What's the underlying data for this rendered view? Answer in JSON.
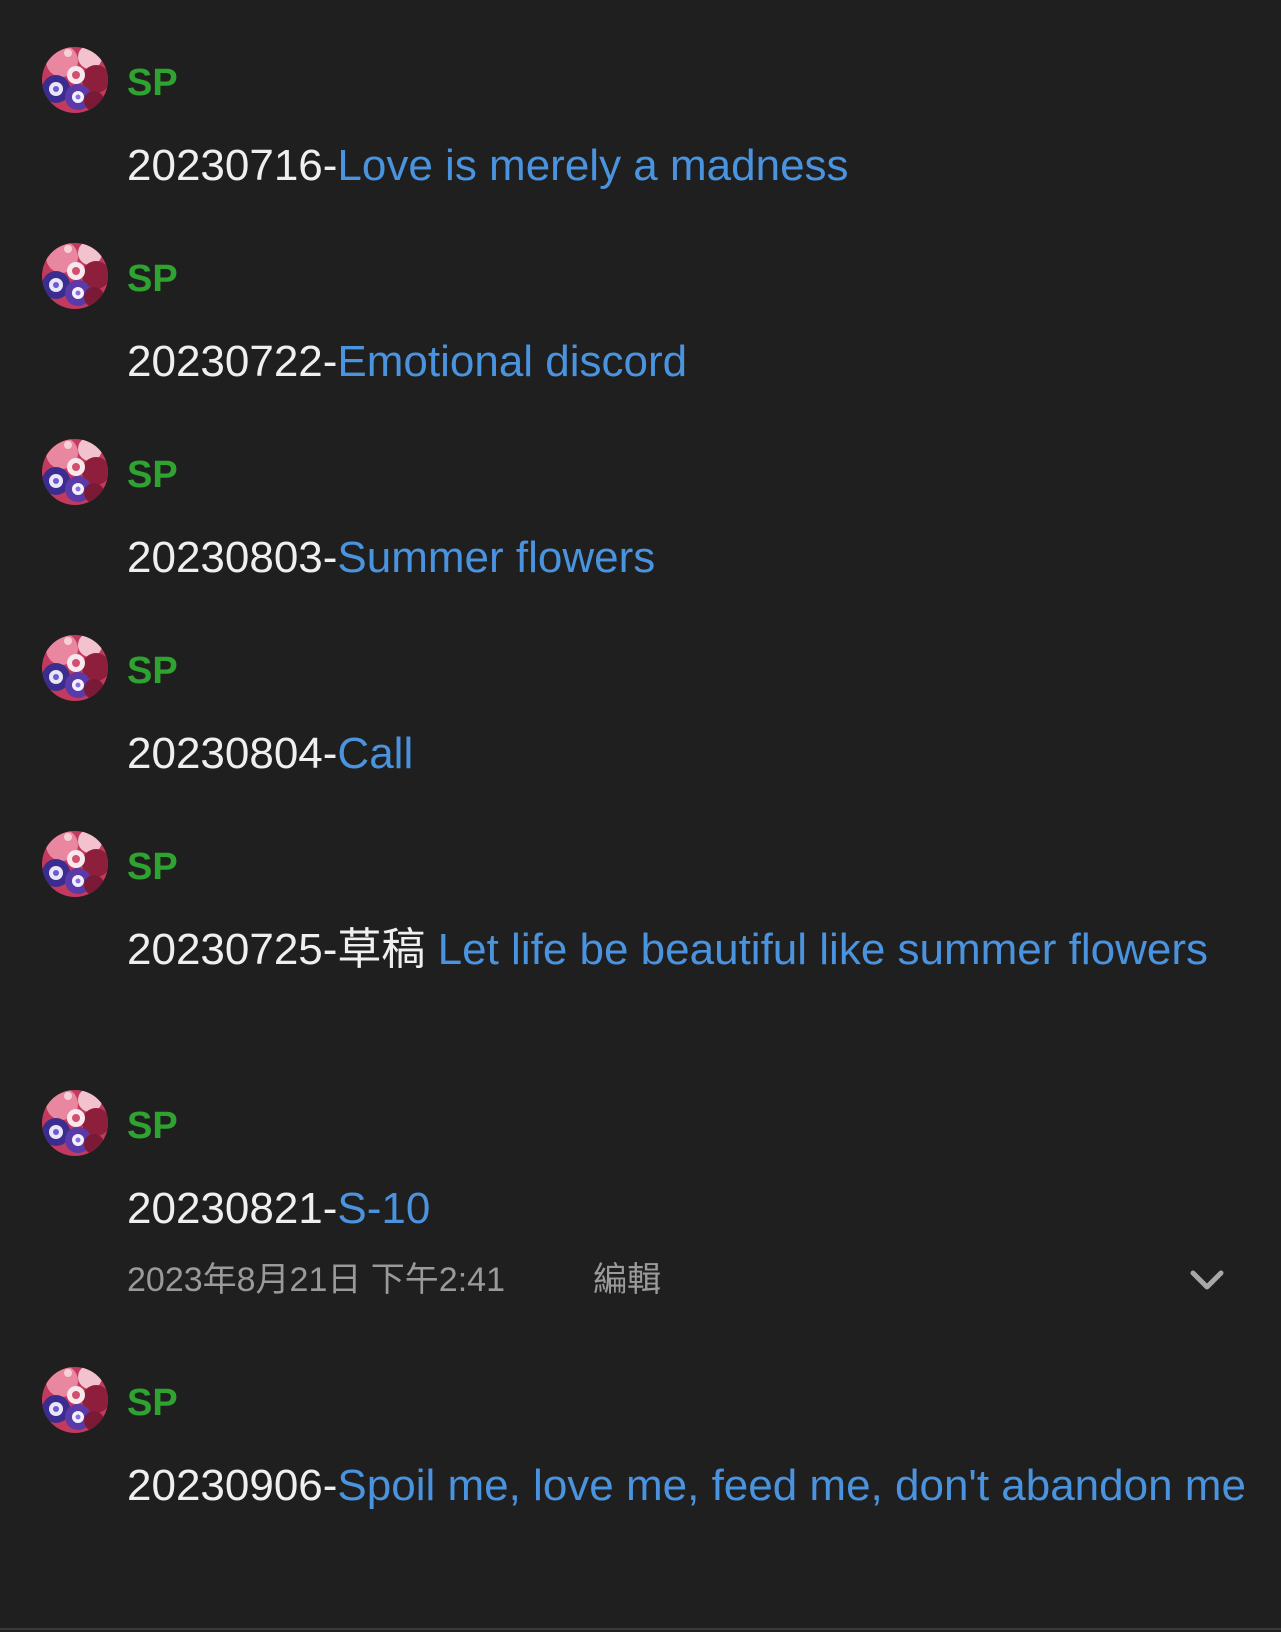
{
  "posts": [
    {
      "author": "SP",
      "prefix": "20230716-",
      "link": "Love is merely a madness"
    },
    {
      "author": "SP",
      "prefix": "20230722-",
      "link": "Emotional discord"
    },
    {
      "author": "SP",
      "prefix": "20230803-",
      "link": "Summer flowers"
    },
    {
      "author": "SP",
      "prefix": "20230804-",
      "link": "Call"
    },
    {
      "author": "SP",
      "prefix": "20230725-草稿 ",
      "link": "Let life be beautiful like summer flowers"
    },
    {
      "author": "SP",
      "prefix": "20230821-",
      "link": "S-10",
      "timestamp": "2023年8月21日 下午2:41",
      "edit_label": "編輯",
      "expand_icon": "chevron-down-icon"
    },
    {
      "author": "SP",
      "prefix": "20230906-",
      "link": "Spoil me, love me, feed me, don't abandon me"
    }
  ],
  "colors": {
    "background": "#1f1f1f",
    "author": "#2fa32f",
    "link": "#4a93df",
    "text": "#efefef",
    "meta": "#9a9a9a"
  }
}
